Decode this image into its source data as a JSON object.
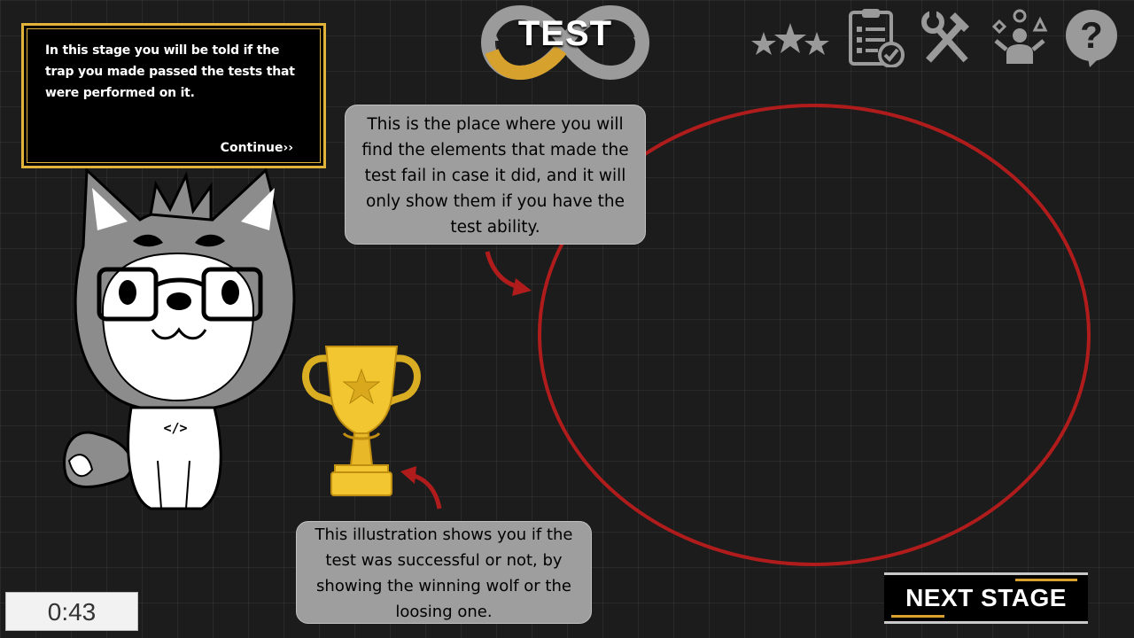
{
  "dialog": {
    "text": "In this stage you will be told if the trap you made passed the tests that were performed on it.",
    "continue_label": "Continue››"
  },
  "stage": {
    "title": "TEST"
  },
  "toolbar": {
    "icons": [
      "stars-icon",
      "checklist-icon",
      "tools-icon",
      "skills-icon",
      "help-icon"
    ],
    "help_glyph": "?"
  },
  "callouts": {
    "elements_area": "This is the place where you will find the elements that made the test fail in case it did, and it will only show them if you have the test ability.",
    "illustration": "This illustration shows you if the test was successful or not, by showing the winning wolf or the loosing one."
  },
  "mascot": {
    "shirt_text": "</>"
  },
  "timer": {
    "value": "0:43"
  },
  "next_stage": {
    "label": "NEXT STAGE"
  },
  "colors": {
    "accent_gold": "#e2b33a",
    "annotation_red": "#b01c1c",
    "callout_gray": "#9e9e9e",
    "icon_gray": "#9a9a9a"
  }
}
